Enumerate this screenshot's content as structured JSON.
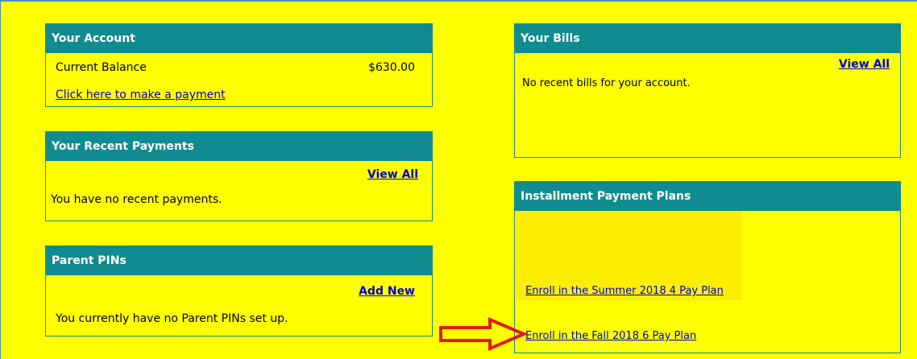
{
  "account": {
    "title": "Your Account",
    "balance_label": "Current Balance",
    "balance_value": "$630.00",
    "payment_link": "Click here to make a payment"
  },
  "recent_payments": {
    "title": "Your Recent Payments",
    "view_all": "View All",
    "message": "You have no recent payments."
  },
  "parent_pins": {
    "title": "Parent PINs",
    "add_new": "Add New",
    "message": "You currently have no Parent PINs set up."
  },
  "bills": {
    "title": "Your Bills",
    "view_all": "View All",
    "message": "No recent bills for your account."
  },
  "installment_plans": {
    "title": "Installment Payment Plans",
    "links": [
      "Enroll in the Summer 2018 4 Pay Plan",
      "Enroll in the Fall 2018 6 Pay Plan"
    ]
  },
  "colors": {
    "page_background": "#ffff00",
    "header_background": "#108b90",
    "header_text": "#ffffff",
    "link": "#0000cc",
    "annotation_arrow": "#e31b1b"
  },
  "annotation": {
    "icon": "red-arrow-right-icon"
  }
}
